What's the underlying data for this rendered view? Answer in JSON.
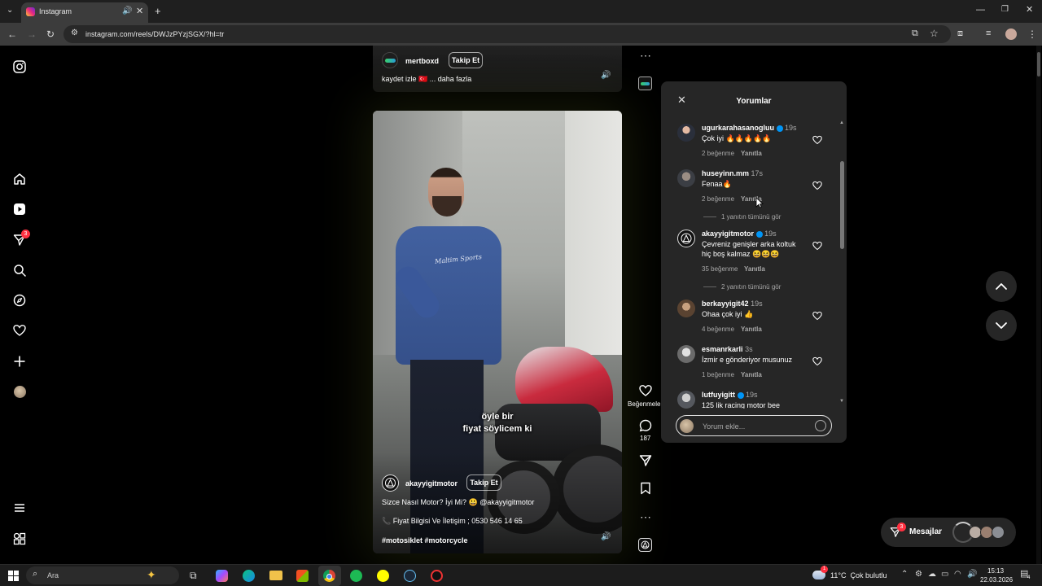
{
  "browser": {
    "tab_title": "Instagram",
    "url": "instagram.com/reels/DWJzPYzjSGX/?hl=tr"
  },
  "sidebar": {
    "notification_badge": "3"
  },
  "reel_top": {
    "username": "mertboxd",
    "follow_label": "Takip Et",
    "caption": "kaydet izle 🇹🇷 ... daha fazla"
  },
  "reel_main": {
    "subtitle_line1": "öyle bir",
    "subtitle_line2": "fiyat söylicem ki",
    "shirt_text": "Maltim Sports",
    "username": "akayyigitmotor",
    "follow_label": "Takip Et",
    "caption_line1": "Sizce Nasıl Motor? İyi Mi? 😃 @akayyigitmotor",
    "caption_line2": "📞 Fiyat Bilgisi Ve İletişim ; 0530 546 14 65",
    "caption_line3": "#motosiklet #motorcycle"
  },
  "actions": {
    "like_label": "Beğenmeler",
    "comment_count": "187"
  },
  "comments_panel": {
    "title": "Yorumlar",
    "input_placeholder": "Yorum ekle...",
    "comments": [
      {
        "user": "ugurkarahasanogluu",
        "time": "19s",
        "text": "Çok iyi 🔥🔥🔥🔥🔥",
        "likes": "2 beğenme",
        "reply": "Yanıtla"
      },
      {
        "user": "huseyinn.mm",
        "time": "17s",
        "text": "Fenaa🔥",
        "likes": "2 beğenme",
        "reply": "Yanıtla",
        "see_replies": "1 yanıtın tümünü gör"
      },
      {
        "user": "akayyigitmotor",
        "time": "19s",
        "text": "Çevreniz genişler arka koltuk hiç boş kalmaz 😆😆😆",
        "likes": "35 beğenme",
        "reply": "Yanıtla",
        "see_replies": "2 yanıtın tümünü gör"
      },
      {
        "user": "berkayyigit42",
        "time": "19s",
        "text": "Ohaa çok iyi 👍",
        "likes": "4 beğenme",
        "reply": "Yanıtla"
      },
      {
        "user": "esmanrkarli",
        "time": "3s",
        "text": "İzmir e gönderiyor musunuz",
        "likes": "1 beğenme",
        "reply": "Yanıtla"
      },
      {
        "user": "lutfuyigitt",
        "time": "19s",
        "text": "125 lik racing motor bee",
        "likes": "",
        "reply": ""
      }
    ]
  },
  "messages": {
    "label": "Mesajlar",
    "badge": "3"
  },
  "taskbar": {
    "search_placeholder": "Ara",
    "weather": "11°C  Çok bulutlu",
    "weather_badge": "1",
    "time": "15:13",
    "date": "22.03.2026",
    "notif_count": "4"
  },
  "colors": {
    "accent_blue": "#0095f6",
    "badge_red": "#ff3040",
    "panel_bg": "#262626"
  }
}
